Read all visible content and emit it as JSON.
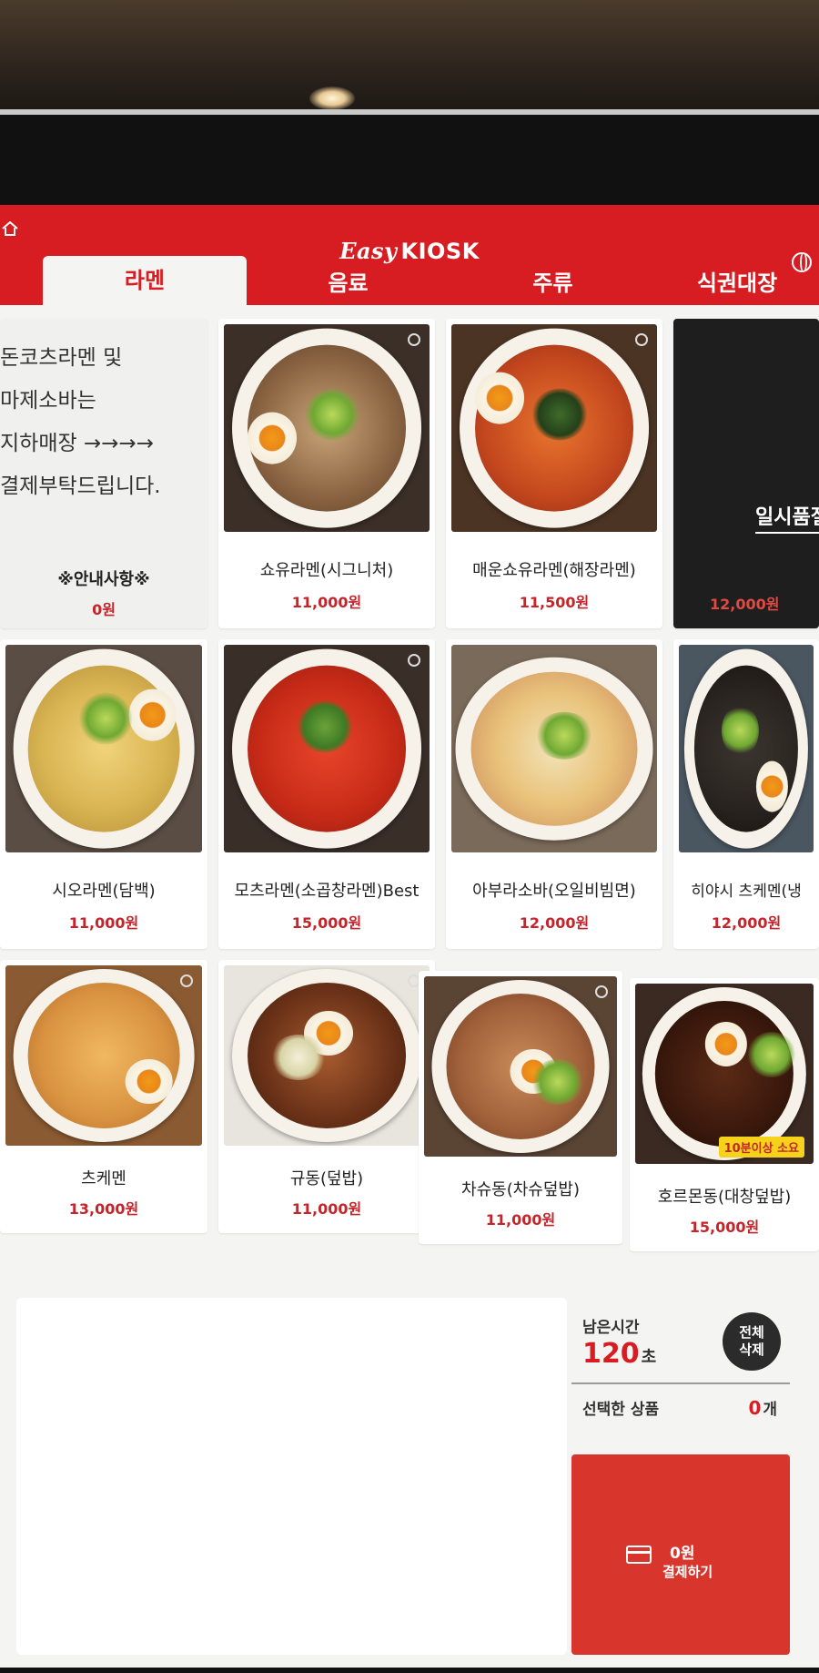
{
  "header": {
    "brand_easy": "Easy",
    "brand_kiosk": "KIOSK",
    "tabs": [
      {
        "label": "라멘",
        "active": true
      },
      {
        "label": "음료",
        "active": false
      },
      {
        "label": "주류",
        "active": false
      },
      {
        "label": "식권대장",
        "active": false
      }
    ],
    "accent_color": "#d81d22"
  },
  "info": {
    "text": "돈코츠라멘 및\n마제소바는\n지하매장 →→→→\n결제부탁드립니다.",
    "name": "※안내사항※",
    "price": "0원"
  },
  "menu": [
    {
      "name": "쇼유라멘(시그니처)",
      "price": "11,000원"
    },
    {
      "name": "매운쇼유라멘(해장라멘)",
      "price": "11,500원"
    },
    {
      "status": "일시품절",
      "price": "12,000원"
    },
    {
      "name": "시오라멘(담백)",
      "price": "11,000원"
    },
    {
      "name": "모츠라멘(소곱창라멘)Best",
      "price": "15,000원"
    },
    {
      "name": "아부라소바(오일비빔면)",
      "price": "12,000원"
    },
    {
      "name": "히야시 츠케멘(냉",
      "price": "12,000원"
    },
    {
      "name": "츠케멘",
      "price": "13,000원"
    },
    {
      "name": "규동(덮밥)",
      "price": "11,000원"
    },
    {
      "name": "차슈동(차슈덮밥)",
      "price": "11,000원"
    },
    {
      "name": "호르몬동(대창덮밥)",
      "price": "15,000원",
      "badge": "10분이상 소요"
    }
  ],
  "summary": {
    "remaining_label": "남은시간",
    "remaining_value": "120",
    "remaining_unit": "초",
    "clear_line1": "전체",
    "clear_line2": "삭제",
    "selected_label": "선택한 상품",
    "selected_count": "0",
    "selected_unit": "개",
    "pay_amount": "0원",
    "pay_label": "결제하기"
  }
}
